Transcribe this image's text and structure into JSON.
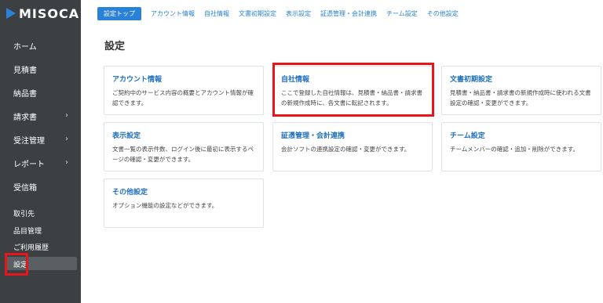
{
  "app": {
    "logo_text": "MISOCA"
  },
  "sidebar": {
    "items": [
      {
        "label": "ホーム",
        "chevron": false
      },
      {
        "label": "見積書",
        "chevron": false
      },
      {
        "label": "納品書",
        "chevron": false
      },
      {
        "label": "請求書",
        "chevron": true
      },
      {
        "label": "受注管理",
        "chevron": true
      },
      {
        "label": "レポート",
        "chevron": true
      },
      {
        "label": "受信箱",
        "chevron": false
      }
    ],
    "sub_items": [
      {
        "label": "取引先"
      },
      {
        "label": "品目管理"
      },
      {
        "label": "ご利用履歴"
      },
      {
        "label": "設定"
      }
    ],
    "chevron_glyph": "›"
  },
  "tabs": [
    {
      "label": "設定トップ",
      "active": true
    },
    {
      "label": "アカウント情報"
    },
    {
      "label": "自社情報"
    },
    {
      "label": "文書初期設定"
    },
    {
      "label": "表示設定"
    },
    {
      "label": "証憑管理・会計連携"
    },
    {
      "label": "チーム設定"
    },
    {
      "label": "その他設定"
    }
  ],
  "page": {
    "title": "設定"
  },
  "cards": [
    {
      "title": "アカウント情報",
      "desc": "ご契約中のサービス内容の概要とアカウント情報が確認できます。"
    },
    {
      "title": "自社情報",
      "desc": "ここで登録した自社情報は、見積書・納品書・請求書の新規作成時に、各文書に転記されます。"
    },
    {
      "title": "文書初期設定",
      "desc": "見積書・納品書・請求書の新規作成時に使われる文書設定の確認・変更ができます。"
    },
    {
      "title": "表示設定",
      "desc": "文書一覧の表示件数、ログイン後に最初に表示するページの確認・変更ができます。"
    },
    {
      "title": "証憑管理・会計連携",
      "desc": "会計ソフトの連携設定の確認・変更ができます。"
    },
    {
      "title": "チーム設定",
      "desc": "チームメンバーの確認・追加・削除ができます。"
    },
    {
      "title": "その他設定",
      "desc": "オプション機能の設定などができます。"
    }
  ],
  "colors": {
    "accent": "#2a82d8",
    "sidebar": "#3c4043",
    "highlight": "#e8151c"
  }
}
